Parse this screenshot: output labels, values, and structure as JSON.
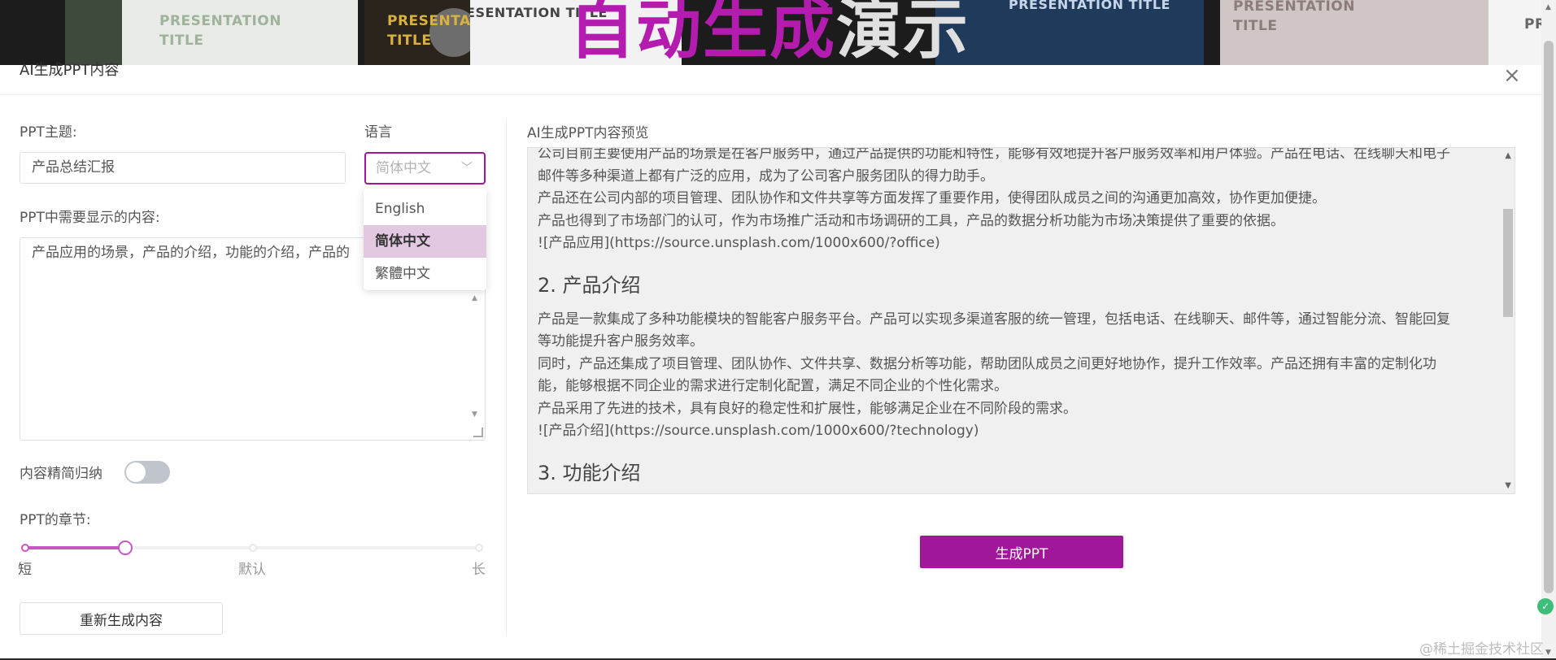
{
  "banner": {
    "thumb_titles": [
      "PRESENTATION\nTITLE",
      "PRESENTATION\nTITLE",
      "PRESENTATION TITLE",
      "PRESENTATION\nTITLE",
      "PR"
    ],
    "big_title_part1": "自动生成",
    "big_title_part2": "演示"
  },
  "modal": {
    "title": "AI生成PPT内容",
    "close_icon": "close-icon"
  },
  "form": {
    "topic_label": "PPT主题:",
    "topic_value": "产品总结汇报",
    "language_label": "语言",
    "language_selected": "简体中文",
    "language_options": [
      "English",
      "简体中文",
      "繁體中文"
    ],
    "content_label": "PPT中需要显示的内容:",
    "content_value": "产品应用的场景，产品的介绍，功能的介绍，产品的",
    "summarize_label": "内容精简归纳",
    "summarize_on": false,
    "chapters_label": "PPT的章节:",
    "chapters_min_label": "短",
    "chapters_default_label": "默认",
    "chapters_max_label": "长",
    "chapters_level": 0.22,
    "regenerate_button": "重新生成内容"
  },
  "preview": {
    "label": "AI生成PPT内容预览",
    "lines_top": [
      "公司目前主要使用产品的场景是在客户服务中，通过产品提供的功能和特性，能够有效地提升客户服务效率和用户体验。产品在电话、在线聊天和电子",
      "邮件等多种渠道上都有广泛的应用，成为了公司客户服务团队的得力助手。",
      "产品还在公司内部的项目管理、团队协作和文件共享等方面发挥了重要作用，使得团队成员之间的沟通更加高效，协作更加便捷。",
      "产品也得到了市场部门的认可，作为市场推广活动和市场调研的工具，产品的数据分析功能为市场决策提供了重要的依据。",
      "![产品应用](https://source.unsplash.com/1000x600/?office)"
    ],
    "heading_2": "2. 产品介绍",
    "lines_mid": [
      "产品是一款集成了多种功能模块的智能客户服务平台。产品可以实现多渠道客服的统一管理，包括电话、在线聊天、邮件等，通过智能分流、智能回复",
      "等功能提升客户服务效率。",
      "同时，产品还集成了项目管理、团队协作、文件共享、数据分析等功能，帮助团队成员之间更好地协作，提升工作效率。产品还拥有丰富的定制化功",
      "能，能够根据不同企业的需求进行定制化配置，满足不同企业的个性化需求。",
      "产品采用了先进的技术，具有良好的稳定性和扩展性，能够满足企业在不同阶段的需求。",
      "![产品介绍](https://source.unsplash.com/1000x600/?technology)"
    ],
    "heading_3": "3. 功能介绍"
  },
  "generate_button": "生成PPT",
  "watermark": "@稀土掘金技术社区",
  "colors": {
    "accent": "#a0179a",
    "accent_light": "#c957c3",
    "selected_option_bg": "#e3c8e2"
  }
}
